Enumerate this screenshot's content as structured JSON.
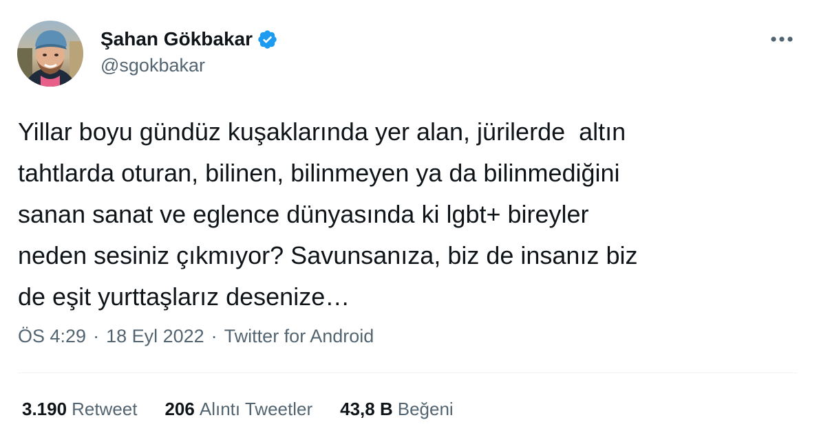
{
  "author": {
    "display_name": "Şahan Gökbakar",
    "handle": "@sgokbakar",
    "verified": true,
    "verified_color": "#1d9bf0"
  },
  "tweet": {
    "text": "Yillar boyu gündüz kuşaklarında yer alan, jürilerde  altın\ntahtlarda oturan, bilinen, bilinmeyen ya da bilinmediğini\nsanan sanat ve eglence dünyasında ki lgbt+ bireyler\nneden sesiniz çıkmıyor? Savunsanıza, biz de insanız biz\nde eşit yurttaşlarız desenize…",
    "time": "ÖS 4:29",
    "date": "18 Eyl 2022",
    "source": "Twitter for Android",
    "separator": "·"
  },
  "stats": {
    "retweets": {
      "count": "3.190",
      "label": "Retweet"
    },
    "quotes": {
      "count": "206",
      "label": "Alıntı Tweetler"
    },
    "likes": {
      "count": "43,8 B",
      "label": "Beğeni"
    }
  },
  "icons": {
    "more": "more-horizontal-icon",
    "verified": "verified-badge-icon"
  },
  "colors": {
    "text_primary": "#0f1419",
    "text_secondary": "#536471",
    "divider": "#eff3f4",
    "accent": "#1d9bf0"
  }
}
